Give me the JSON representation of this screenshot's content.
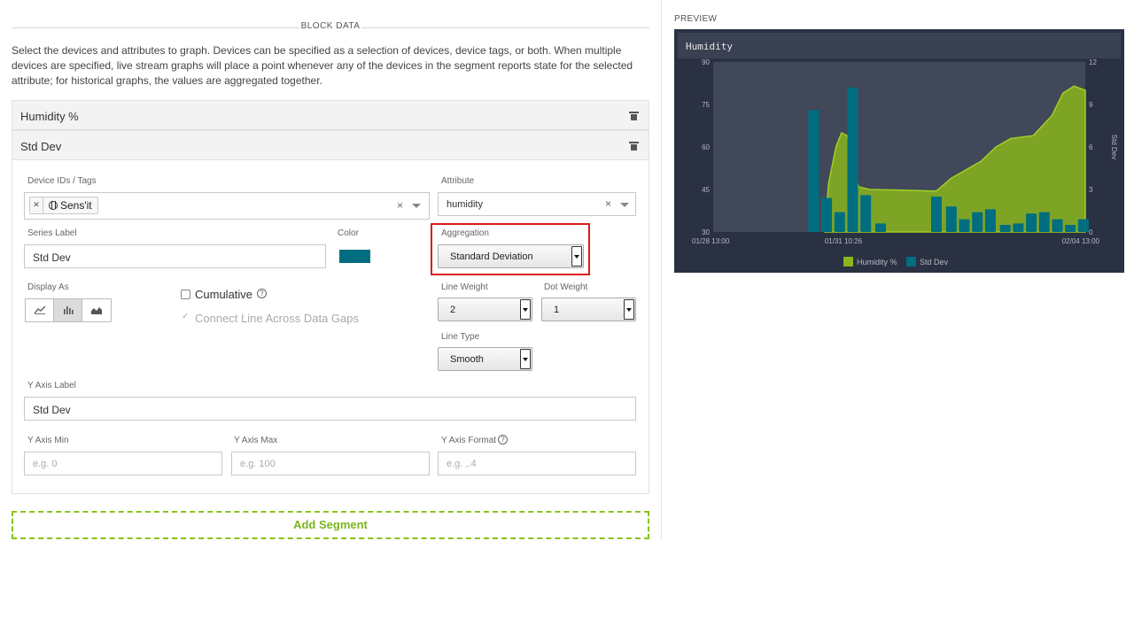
{
  "editor": {
    "section_title": "BLOCK DATA",
    "intro": "Select the devices and attributes to graph. Devices can be specified as a selection of devices, device tags, or both. When multiple devices are specified, live stream graphs will place a point whenever any of the devices in the segment reports state for the selected attribute; for historical graphs, the values are aggregated together.",
    "segments": [
      {
        "title": "Humidity %"
      },
      {
        "title": "Std Dev"
      }
    ],
    "form": {
      "device_ids_label": "Device IDs / Tags",
      "device_tag": "Sens'it",
      "attribute_label": "Attribute",
      "attribute_value": "humidity",
      "series_label_label": "Series Label",
      "series_label_value": "Std Dev",
      "color_label": "Color",
      "color_value": "#006e7f",
      "aggregation_label": "Aggregation",
      "aggregation_value": "Standard Deviation",
      "display_as_label": "Display As",
      "display_as_selected": "bar",
      "cumulative_label": "Cumulative",
      "connect_label": "Connect Line Across Data Gaps",
      "line_weight_label": "Line Weight",
      "line_weight_value": "2",
      "dot_weight_label": "Dot Weight",
      "dot_weight_value": "1",
      "line_type_label": "Line Type",
      "line_type_value": "Smooth",
      "y_axis_label_label": "Y Axis Label",
      "y_axis_label_value": "Std Dev",
      "y_min_label": "Y Axis Min",
      "y_min_placeholder": "e.g. 0",
      "y_max_label": "Y Axis Max",
      "y_max_placeholder": "e.g. 100",
      "y_format_label": "Y Axis Format",
      "y_format_placeholder": "e.g. ,.4"
    },
    "add_segment_label": "Add Segment"
  },
  "preview": {
    "title": "PREVIEW",
    "block_title": "Humidity"
  },
  "chart_data": {
    "type": "bar",
    "x_tick_labels": [
      "01/28 13:00",
      "01/31 10:26",
      "02/04 13:00"
    ],
    "y_left": {
      "range": [
        30,
        90
      ],
      "ticks": [
        30,
        45,
        60,
        75,
        90
      ]
    },
    "y_right": {
      "label": "Std Dev",
      "range": [
        0,
        12
      ],
      "ticks": [
        0,
        3,
        6,
        9,
        12
      ]
    },
    "legend_placement": "bottom",
    "series": [
      {
        "name": "Humidity %",
        "type": "area",
        "color": "#8ab51d",
        "axis": "left",
        "x": [
          0.3,
          0.31,
          0.33,
          0.345,
          0.36,
          0.375,
          0.39,
          0.42,
          0.5,
          0.58,
          0.6,
          0.64,
          0.68,
          0.72,
          0.76,
          0.8,
          0.86,
          0.91,
          0.94,
          0.97,
          1.0
        ],
        "values": [
          30,
          47,
          60,
          65,
          64,
          55,
          46,
          45,
          44.8,
          44.5,
          44.5,
          49,
          52,
          55,
          60,
          63,
          64,
          71,
          79,
          81.5,
          80
        ]
      },
      {
        "name": "Std Dev",
        "type": "bar",
        "color": "#006e7f",
        "axis": "right",
        "x": [
          0.27,
          0.305,
          0.34,
          0.375,
          0.41,
          0.45,
          0.6,
          0.64,
          0.675,
          0.71,
          0.745,
          0.785,
          0.82,
          0.855,
          0.89,
          0.925,
          0.96,
          0.995
        ],
        "values": [
          8.6,
          2.4,
          1.4,
          10.2,
          2.6,
          0.6,
          2.5,
          1.8,
          0.9,
          1.4,
          1.6,
          0.5,
          0.6,
          1.3,
          1.4,
          0.9,
          0.5,
          0.9
        ]
      }
    ]
  }
}
